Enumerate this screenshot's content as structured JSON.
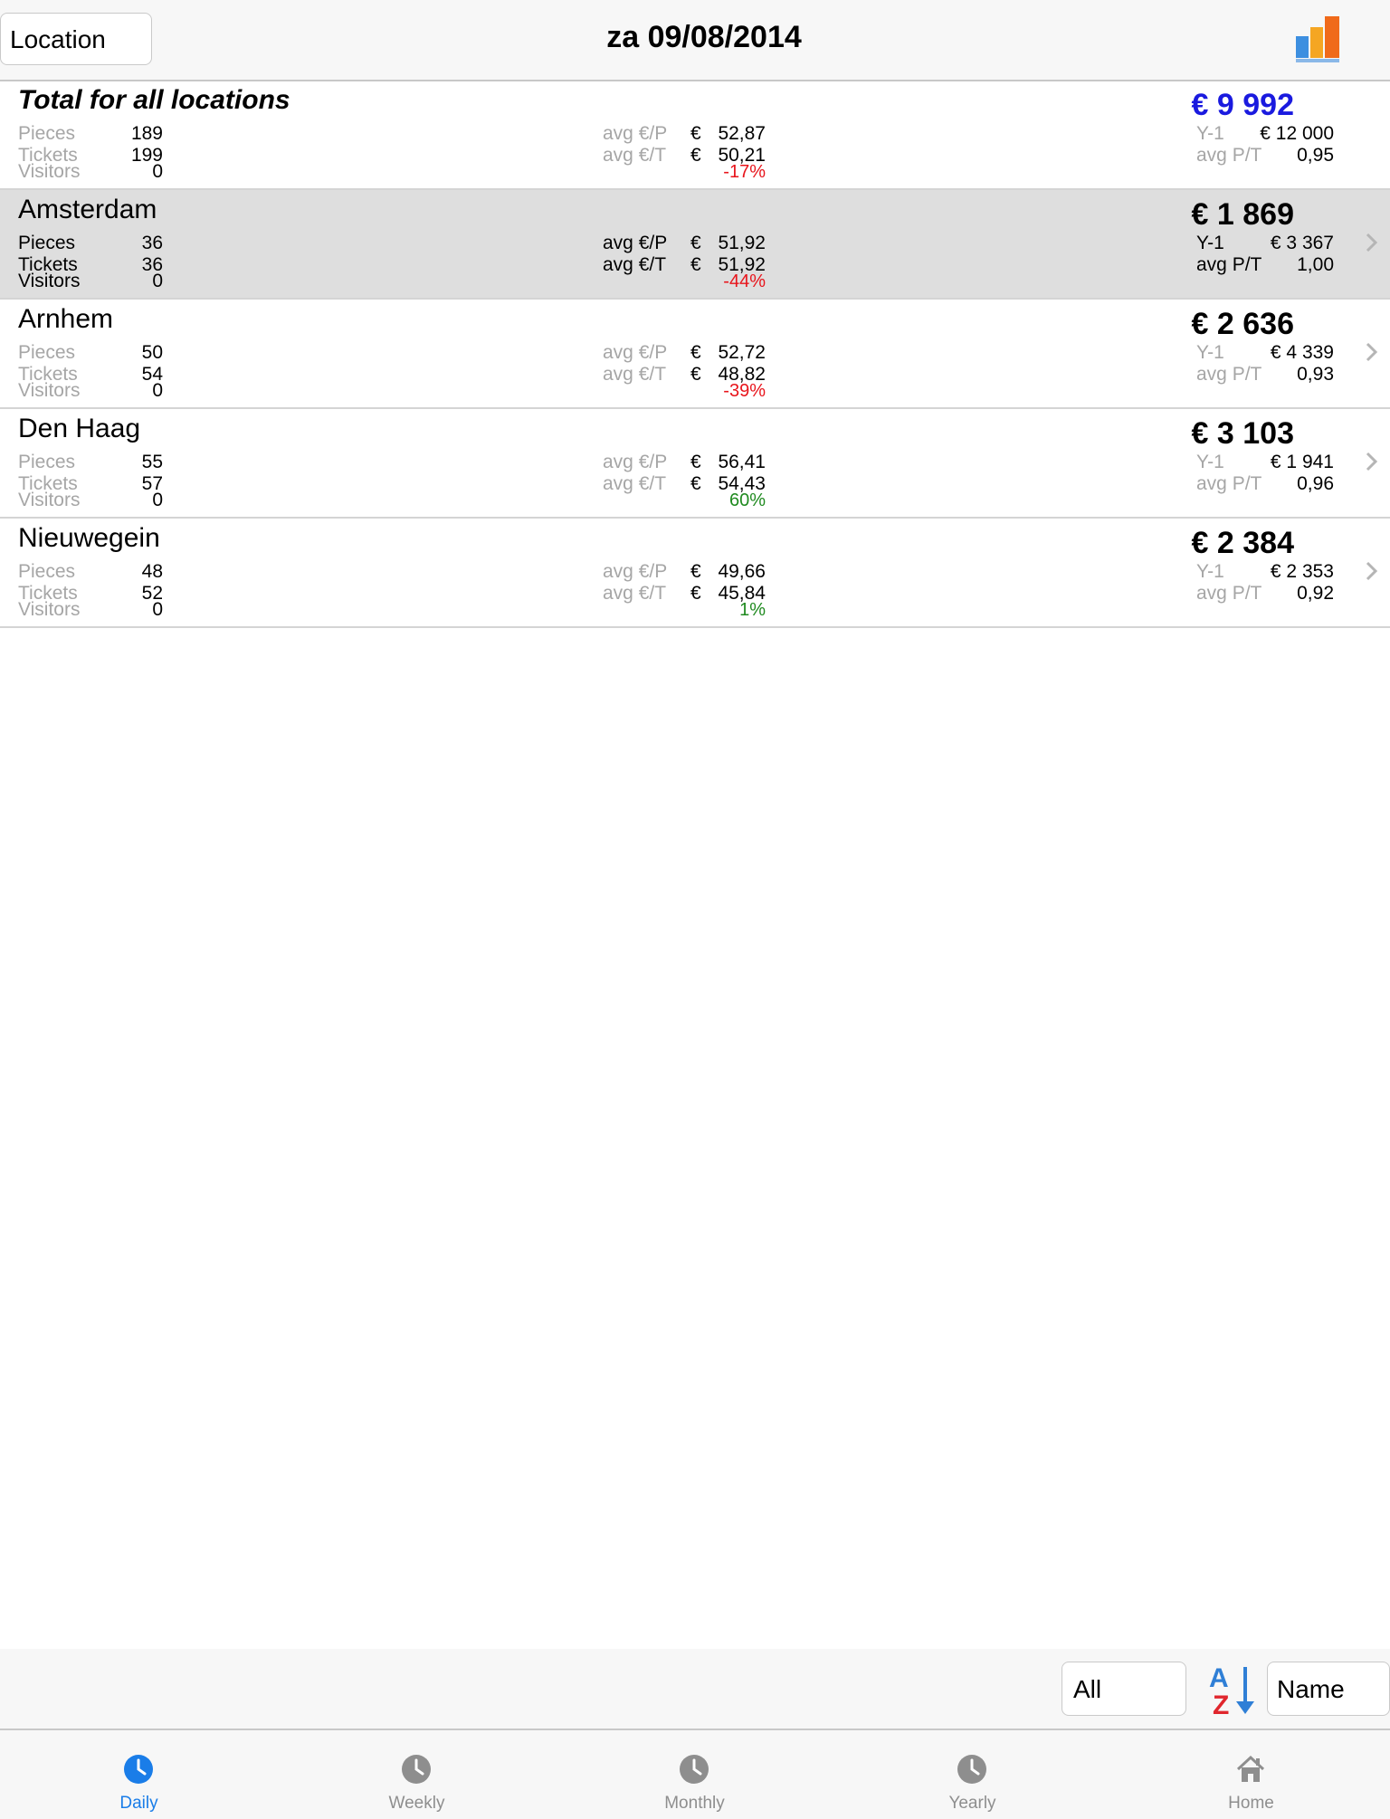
{
  "header": {
    "location_button": "Location",
    "date_title": "za 09/08/2014",
    "chart_icon": "bar-chart-icon"
  },
  "labels": {
    "pieces": "Pieces",
    "tickets": "Tickets",
    "visitors": "Visitors",
    "avg_ep": "avg €/P",
    "avg_et": "avg €/T",
    "y1": "Y-1",
    "avg_pt": "avg P/T",
    "currency": "€"
  },
  "total": {
    "name": "Total for all locations",
    "amount": "€ 9 992",
    "pieces": "189",
    "tickets": "199",
    "visitors": "0",
    "avg_ep": "52,87",
    "avg_et": "50,21",
    "change": "-17%",
    "change_color": "#e8141b",
    "y1": "€ 12 000",
    "avg_pt": "0,95"
  },
  "locations": [
    {
      "name": "Amsterdam",
      "amount": "€ 1 869",
      "pieces": "36",
      "tickets": "36",
      "visitors": "0",
      "avg_ep": "51,92",
      "avg_et": "51,92",
      "change": "-44%",
      "change_color": "#e8141b",
      "y1": "€ 3 367",
      "avg_pt": "1,00",
      "selected": true
    },
    {
      "name": "Arnhem",
      "amount": "€ 2 636",
      "pieces": "50",
      "tickets": "54",
      "visitors": "0",
      "avg_ep": "52,72",
      "avg_et": "48,82",
      "change": "-39%",
      "change_color": "#e8141b",
      "y1": "€ 4 339",
      "avg_pt": "0,93",
      "selected": false
    },
    {
      "name": "Den Haag",
      "amount": "€ 3 103",
      "pieces": "55",
      "tickets": "57",
      "visitors": "0",
      "avg_ep": "56,41",
      "avg_et": "54,43",
      "change": "60%",
      "change_color": "#1f8a1f",
      "y1": "€ 1 941",
      "avg_pt": "0,96",
      "selected": false
    },
    {
      "name": "Nieuwegein",
      "amount": "€ 2 384",
      "pieces": "48",
      "tickets": "52",
      "visitors": "0",
      "avg_ep": "49,66",
      "avg_et": "45,84",
      "change": "1%",
      "change_color": "#1f8a1f",
      "y1": "€ 2 353",
      "avg_pt": "0,92",
      "selected": false
    }
  ],
  "filter": {
    "scope_value": "All",
    "sort_icon": "sort-az-icon",
    "sort_value": "Name"
  },
  "tabs": [
    {
      "label": "Daily",
      "icon": "clock-icon",
      "active": true
    },
    {
      "label": "Weekly",
      "icon": "clock-icon",
      "active": false
    },
    {
      "label": "Monthly",
      "icon": "clock-icon",
      "active": false
    },
    {
      "label": "Yearly",
      "icon": "clock-icon",
      "active": false
    },
    {
      "label": "Home",
      "icon": "home-icon",
      "active": false
    }
  ],
  "colors": {
    "accent": "#1a7de8",
    "total_amount": "#1a1adf",
    "negative": "#e8141b",
    "positive": "#1f8a1f"
  }
}
